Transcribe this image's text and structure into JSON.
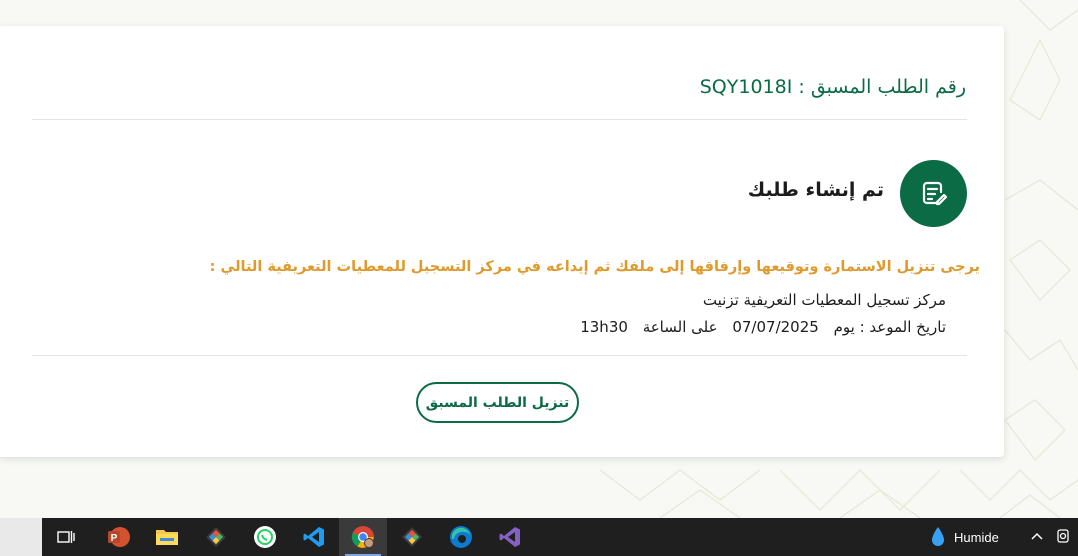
{
  "request": {
    "reference_label": "رقم الطلب المسبق :",
    "reference_value": "SQY1018I",
    "created_message": "تم إنشاء طلبك",
    "notice": "يرجى تنزيل الاستمارة وتوقيعها وإرفاقها إلى ملفك ثم إيداعه في مركز التسجيل للمعطيات التعريفية التالي :",
    "center_name": "مركز تسجيل المعطيات التعريفية تزنيت",
    "appointment_label": "تاريخ الموعد : يوم",
    "appointment_date": "07/07/2025",
    "appointment_time_label": "على الساعة",
    "appointment_time": "13h30",
    "download_button": "تنزيل الطلب المسبق"
  },
  "taskbar": {
    "apps": [
      {
        "name": "task-view-icon"
      },
      {
        "name": "powerpoint-icon"
      },
      {
        "name": "file-explorer-icon"
      },
      {
        "name": "git-icon"
      },
      {
        "name": "whatsapp-icon"
      },
      {
        "name": "vscode-icon"
      },
      {
        "name": "chrome-icon",
        "active": true
      },
      {
        "name": "git-icon"
      },
      {
        "name": "edge-icon"
      },
      {
        "name": "visual-studio-icon"
      }
    ],
    "weather_text": "Humide"
  },
  "colors": {
    "brand_green": "#0a6b44",
    "notice_orange": "#e0992b"
  }
}
